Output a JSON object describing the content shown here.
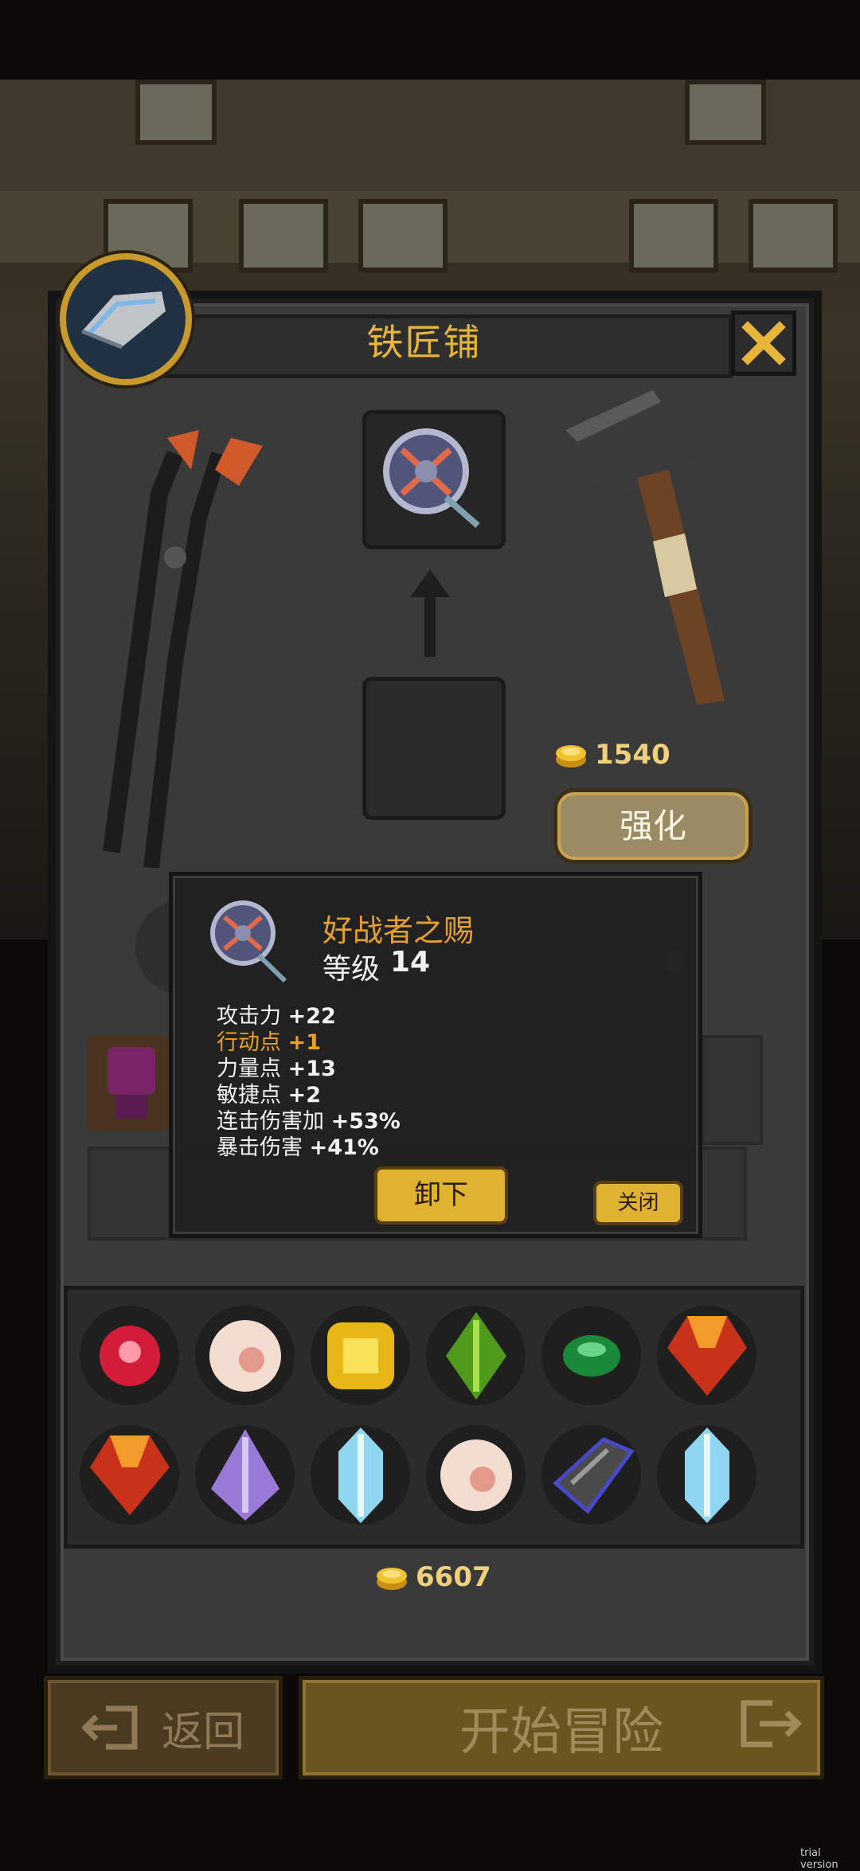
{
  "dialog": {
    "title": "铁匠铺"
  },
  "upgrade": {
    "cost": "1540",
    "enhance_label": "强化"
  },
  "tooltip": {
    "item_name": "好战者之赐",
    "level_label": "等级",
    "level_value": "14",
    "stats": [
      {
        "name": "攻击力",
        "value": "+22",
        "highlight": false
      },
      {
        "name": "行动点",
        "value": "+1",
        "highlight": true
      },
      {
        "name": "力量点",
        "value": "+13",
        "highlight": false
      },
      {
        "name": "敏捷点",
        "value": "+2",
        "highlight": false
      },
      {
        "name": "连击伤害加",
        "value": "+53%",
        "highlight": false
      },
      {
        "name": "暴击伤害",
        "value": "+41%",
        "highlight": false
      }
    ],
    "unequip_label": "卸下",
    "close_label": "关闭"
  },
  "inventory": {
    "gems": [
      "red-gem-icon",
      "pearl-icon",
      "topaz-icon",
      "green-crystal-icon",
      "emerald-icon",
      "ruby-icon",
      "ruby-icon",
      "amethyst-icon",
      "ice-crystal-icon",
      "pearl-icon",
      "obsidian-icon",
      "ice-crystal-icon"
    ],
    "gold": "6607"
  },
  "footer": {
    "back_label": "返回",
    "start_label": "开始冒险"
  },
  "watermark": "trial version",
  "colors": {
    "accent_gold": "#e7b53a",
    "highlight_orange": "#e7a02b",
    "button_gold": "#e0b232"
  }
}
